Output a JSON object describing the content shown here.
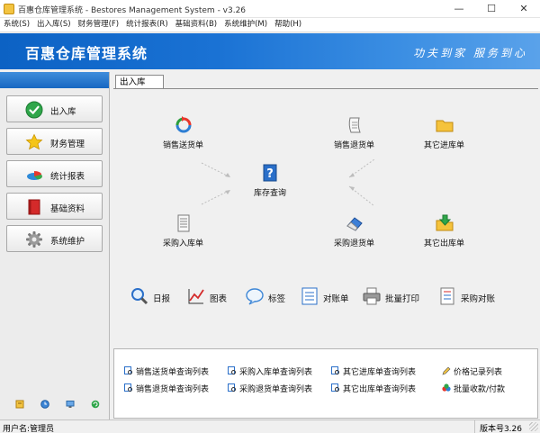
{
  "window": {
    "title": "百惠仓库管理系统 - Bestores Management System - v3.26",
    "minimize_glyph": "—",
    "maximize_glyph": "☐",
    "close_glyph": "✕"
  },
  "menu": [
    "系统(S)",
    "出入库(S)",
    "财务管理(F)",
    "统计报表(R)",
    "基础资料(B)",
    "系统维护(M)",
    "帮助(H)"
  ],
  "banner": {
    "system_name": "百惠仓库管理系统",
    "slogan": "功夫到家  服务到心",
    "colors": {
      "start": "#0c62c4",
      "end": "#5aa2ea"
    }
  },
  "sidebar": {
    "items": [
      {
        "label": "出入库",
        "icon": "check-circle-icon"
      },
      {
        "label": "财务管理",
        "icon": "star-icon"
      },
      {
        "label": "统计报表",
        "icon": "pie-chart-icon"
      },
      {
        "label": "基础资料",
        "icon": "book-icon"
      },
      {
        "label": "系统维护",
        "icon": "gear-icon"
      }
    ],
    "footer_icons": [
      "notepad-icon",
      "clock-icon",
      "monitor-icon",
      "refresh-icon"
    ]
  },
  "tab": {
    "label": "出入库"
  },
  "flow": {
    "sales_delivery": "销售送货单",
    "sales_return": "销售退货单",
    "other_in": "其它进库单",
    "inventory_query": "库存查询",
    "purchase_in": "采购入库单",
    "purchase_return": "采购退货单",
    "other_out": "其它出库单"
  },
  "tools": [
    "日报",
    "图表",
    "标签",
    "对账单",
    "批量打印",
    "采购对账"
  ],
  "quick_lists": {
    "row1": [
      "销售送货单查询列表",
      "采购入库单查询列表",
      "其它进库单查询列表",
      "价格记录列表"
    ],
    "row2": [
      "销售退货单查询列表",
      "采购退货单查询列表",
      "其它出库单查询列表",
      "批量收款/付款"
    ]
  },
  "status": {
    "user": "用户名:管理员",
    "version": "版本号3.26"
  }
}
